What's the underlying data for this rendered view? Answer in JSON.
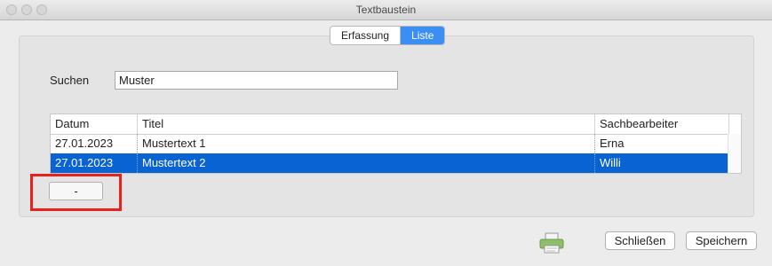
{
  "window": {
    "title": "Textbaustein"
  },
  "tabs": [
    {
      "label": "Erfassung",
      "active": false
    },
    {
      "label": "Liste",
      "active": true
    }
  ],
  "search": {
    "label": "Suchen",
    "value": "Muster"
  },
  "table": {
    "columns": [
      "Datum",
      "Titel",
      "Sachbearbeiter"
    ],
    "rows": [
      {
        "date": "27.01.2023",
        "title": "Mustertext 1",
        "clerk": "Erna",
        "selected": false
      },
      {
        "date": "27.01.2023",
        "title": "Mustertext 2",
        "clerk": "Willi",
        "selected": true
      }
    ]
  },
  "actions": {
    "remove_label": "-"
  },
  "footer": {
    "close_label": "Schließen",
    "save_label": "Speichern",
    "print_icon": "printer-icon"
  },
  "colors": {
    "selection": "#0a63d3",
    "tab_active": "#3b8ef3",
    "highlight": "#e8211d"
  }
}
